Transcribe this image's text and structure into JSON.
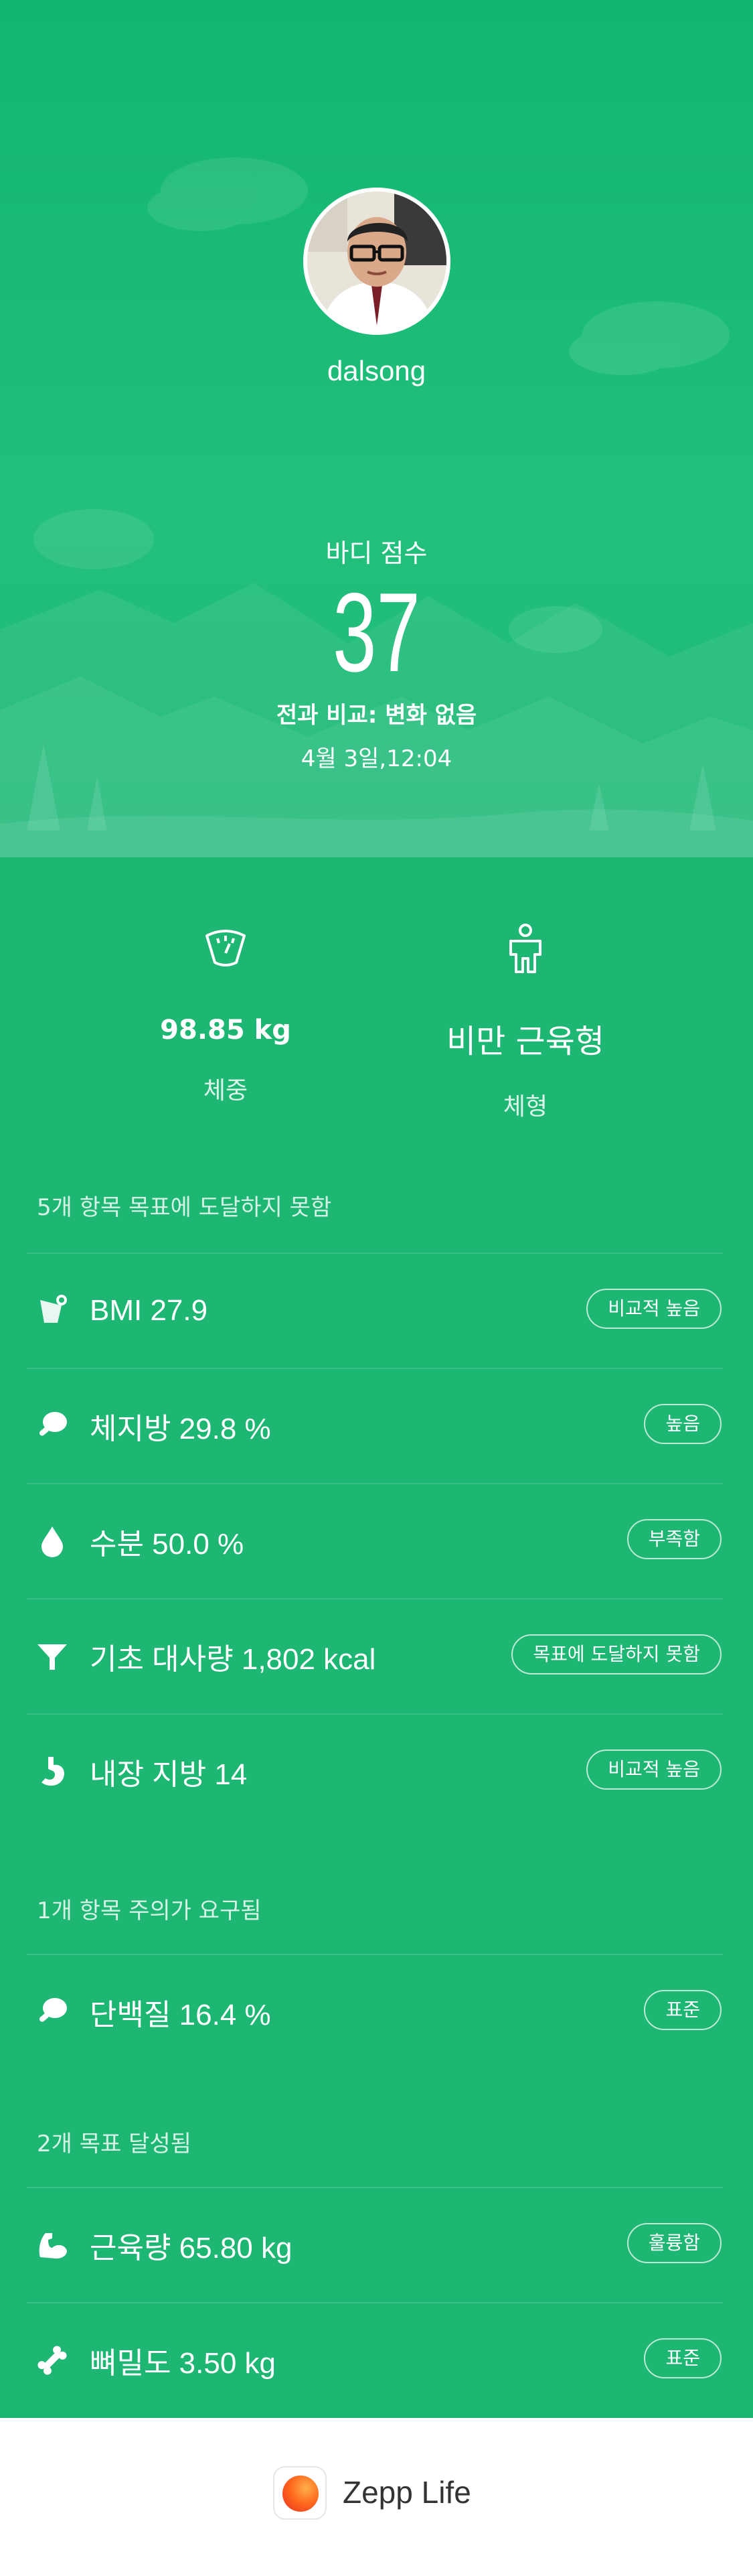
{
  "profile": {
    "username": "dalsong"
  },
  "body_score": {
    "label": "바디 점수",
    "score": "37",
    "comparison": "전과 비교: 변화 없음",
    "date": "4월 3일,12:04"
  },
  "summary": {
    "weight_value": "98.85 kg",
    "weight_caption": "체중",
    "body_type_value": "비만 근육형",
    "body_type_caption": "체형"
  },
  "sections": {
    "not_reached_title": "5개 항목 목표에 도달하지 못함",
    "attention_title": "1개 항목 주의가 요구됨",
    "achieved_title": "2개 목표 달성됨"
  },
  "metrics": {
    "bmi": {
      "label": "BMI 27.9",
      "status": "비교적 높음",
      "icon": "bmi-icon"
    },
    "body_fat": {
      "label": "체지방 29.8 %",
      "status": "높음",
      "icon": "drumstick-icon"
    },
    "water": {
      "label": "수분 50.0 %",
      "status": "부족함",
      "icon": "water-drop-icon"
    },
    "bmr": {
      "label": "기초 대사량 1,802 kcal",
      "status": "목표에 도달하지 못함",
      "icon": "funnel-icon"
    },
    "visceral_fat": {
      "label": "내장 지방 14",
      "status": "비교적 높음",
      "icon": "stomach-icon"
    },
    "protein": {
      "label": "단백질 16.4 %",
      "status": "표준",
      "icon": "drumstick-icon"
    },
    "muscle": {
      "label": "근육량 65.80 kg",
      "status": "훌륭함",
      "icon": "muscle-arm-icon"
    },
    "bone": {
      "label": "뼈밀도 3.50 kg",
      "status": "표준",
      "icon": "bone-icon"
    }
  },
  "footer": {
    "brand": "Zepp Life"
  },
  "colors": {
    "primary_green": "#1db673",
    "header_green": "#10b571",
    "text": "#ffffff"
  }
}
